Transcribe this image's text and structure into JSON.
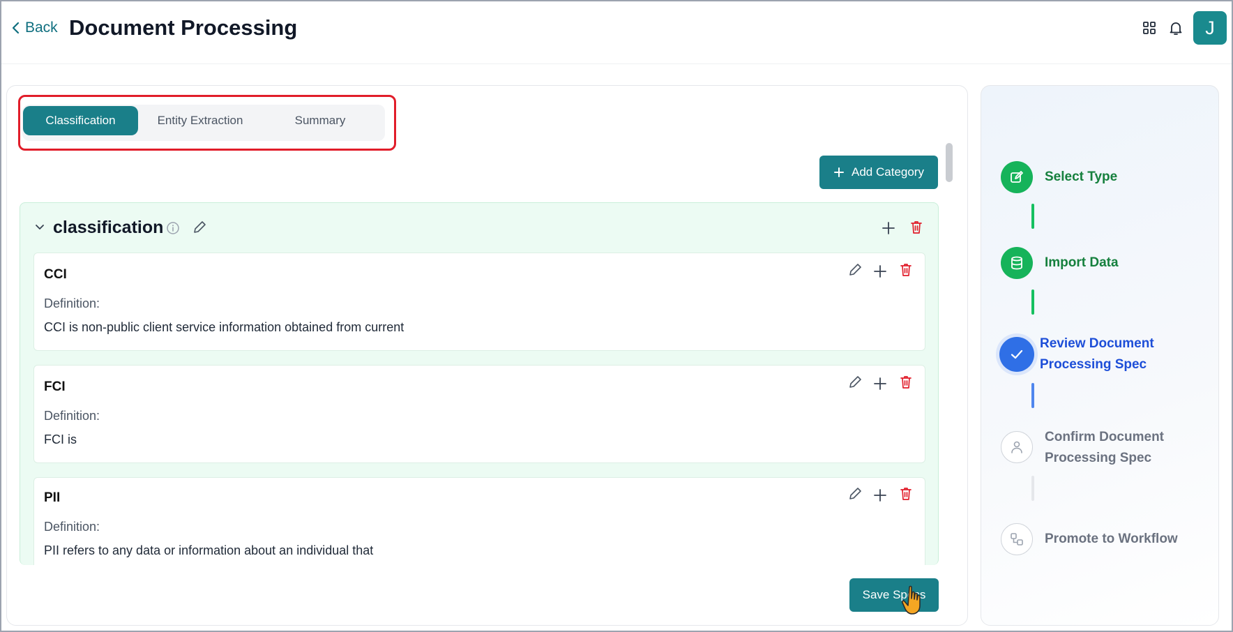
{
  "header": {
    "back_label": "Back",
    "title": "Document Processing",
    "avatar_initial": "J",
    "icons": [
      "grid-icon",
      "bell-icon"
    ]
  },
  "tabs": [
    {
      "label": "Classification",
      "active": true
    },
    {
      "label": "Entity Extraction",
      "active": false
    },
    {
      "label": "Summary",
      "active": false
    }
  ],
  "add_category_label": "Add Category",
  "category": {
    "name": "classification",
    "items": [
      {
        "name": "CCI",
        "definition_label": "Definition:",
        "definition": "CCI is non-public client service information obtained from current"
      },
      {
        "name": "FCI",
        "definition_label": "Definition:",
        "definition": "FCI is"
      },
      {
        "name": "PII",
        "definition_label": "Definition:",
        "definition": "PII refers to any data or information about an individual that"
      }
    ]
  },
  "save_label": "Save Specs",
  "steps": [
    {
      "label": "Select Type",
      "status": "done",
      "icon": "edit-icon"
    },
    {
      "label": "Import Data",
      "status": "done",
      "icon": "database-icon"
    },
    {
      "label_line1": "Review Document",
      "label_line2": "Processing Spec",
      "status": "active",
      "icon": "check-icon"
    },
    {
      "label_line1": "Confirm Document",
      "label_line2": "Processing Spec",
      "status": "todo",
      "icon": "user-icon"
    },
    {
      "label": "Promote to Workflow",
      "status": "todo",
      "icon": "workflow-icon"
    }
  ],
  "colors": {
    "primary": "#1a7f89",
    "success": "#16b35a",
    "active": "#2f6fe6",
    "danger": "#e11d2a",
    "highlight_box": "#e11d2a"
  }
}
